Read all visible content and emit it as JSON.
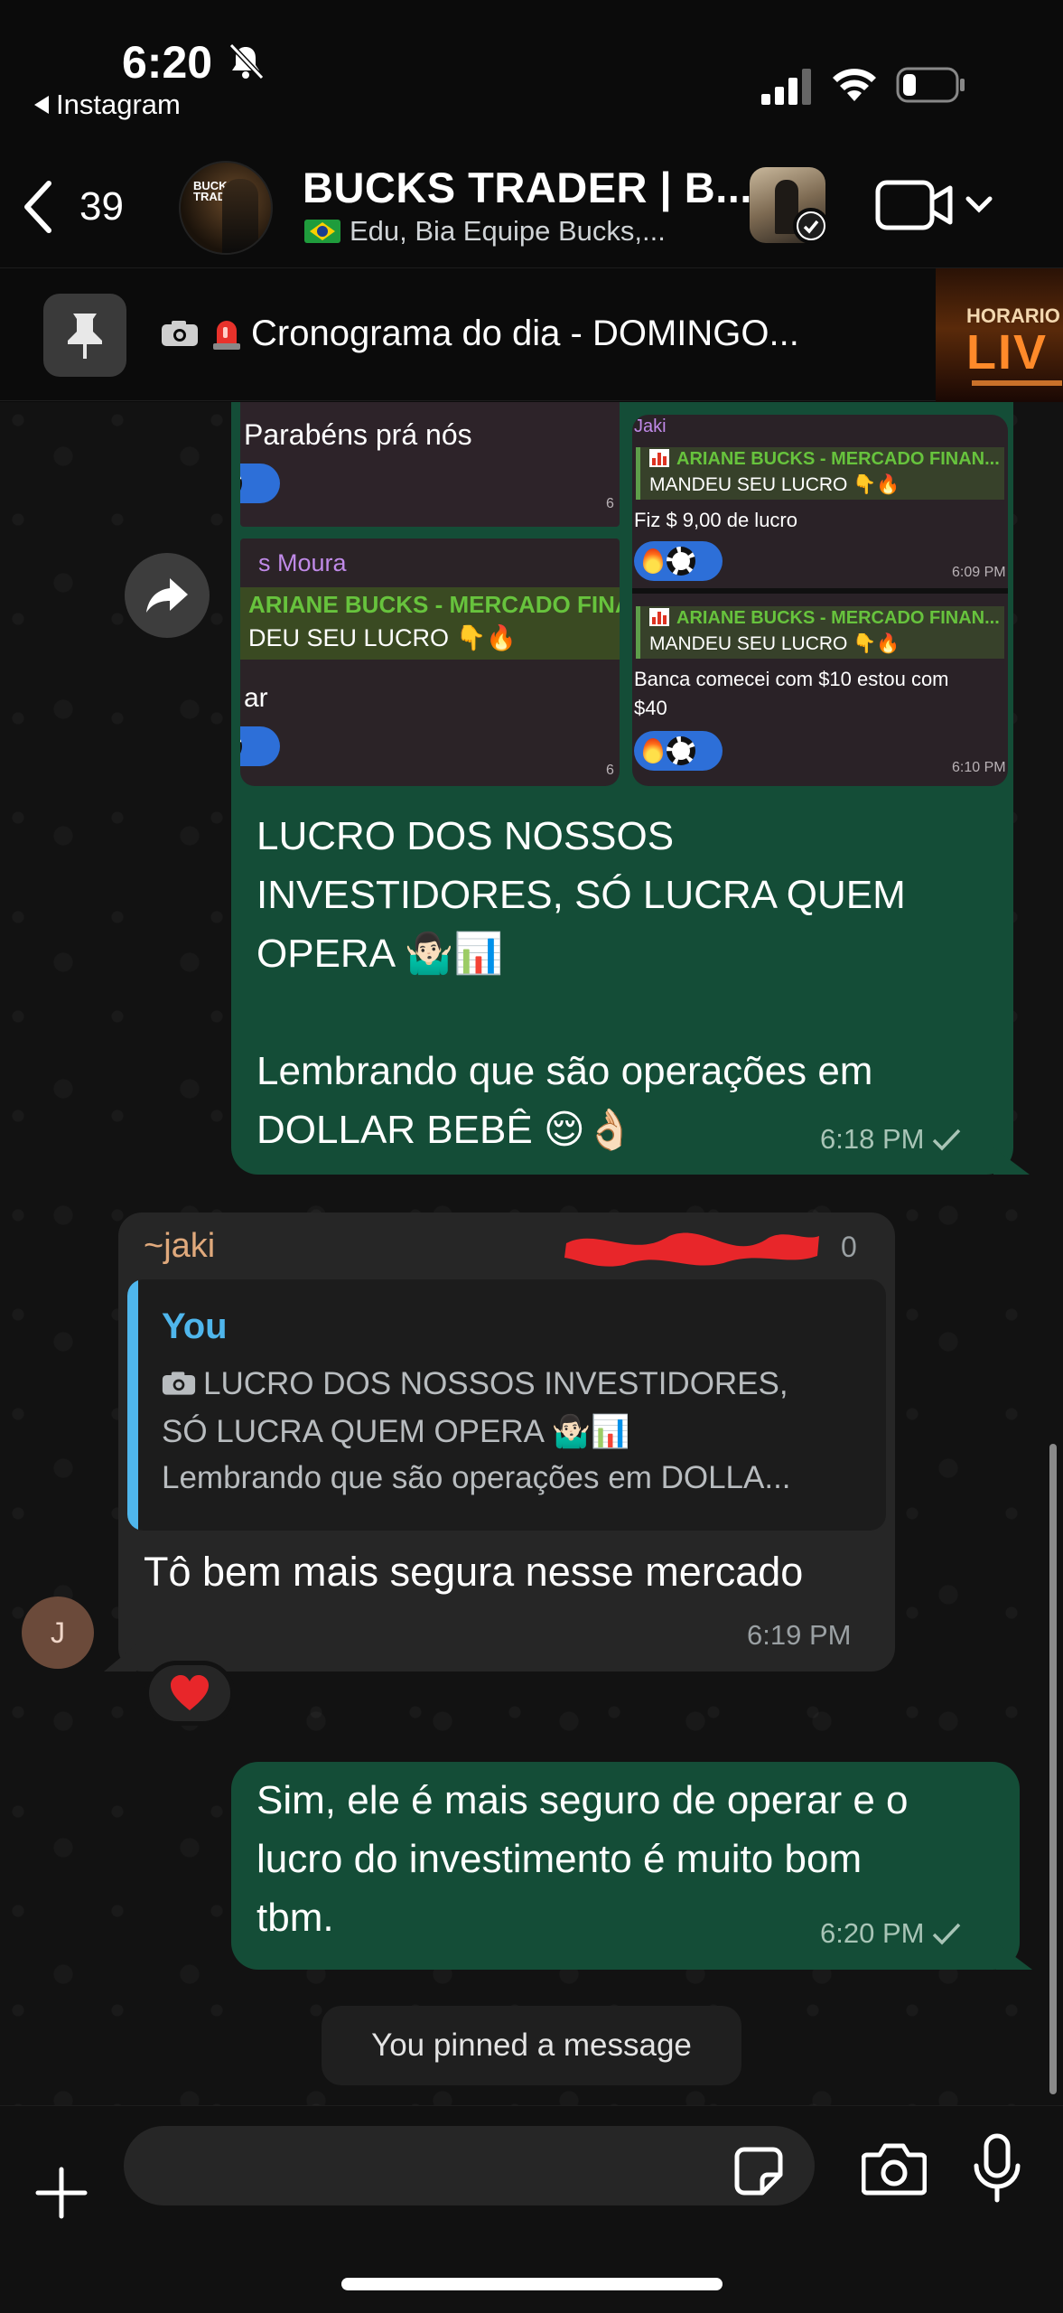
{
  "status_bar": {
    "time": "6:20",
    "back_app": "Instagram"
  },
  "header": {
    "back_count": "39",
    "title": "BUCKS TRADER | B...",
    "subtitle": "Edu, Bia Equipe Bucks,...",
    "avatar_logo": "BUCKS TRADER"
  },
  "pinned": {
    "text": "Cronograma do dia - DOMINGO...",
    "thumb_line1": "HORARIO",
    "thumb_line2": "LIV"
  },
  "media_message": {
    "panes": {
      "left_top_text": "Parabéns prá nós",
      "left_top_time": "6",
      "left_bottom_name": "s Moura",
      "left_bottom_quote_title": "ARIANE BUCKS - MERCADO FINA",
      "left_bottom_quote_text": "DEU SEU LUCRO",
      "left_bottom_text": "ar",
      "left_bottom_time": "6",
      "right_name": "Jaki",
      "right_quote1_title": "ARIANE BUCKS - MERCADO FINAN...",
      "right_quote1_text": "MANDEU SEU LUCRO",
      "right_text1": "Fiz $ 9,00 de lucro",
      "right_time1": "6:09 PM",
      "right_quote2_title": "ARIANE BUCKS - MERCADO FINAN...",
      "right_quote2_text": "MANDEU SEU LUCRO",
      "right_text2a": "Banca comecei com $10 estou com",
      "right_text2b": "$40",
      "right_time2": "6:10 PM"
    },
    "text_line1": "LUCRO DOS NOSSOS",
    "text_line2": "INVESTIDORES, SÓ LUCRA QUEM",
    "text_line3": "OPERA 🤷🏻‍♂️📊",
    "text_line4": "Lembrando que são operações em",
    "text_line5": "DOLLAR BEBÊ 😌👌🏻",
    "time": "6:18 PM"
  },
  "reply_message": {
    "sender": "~jaki",
    "sender_suffix": "0",
    "quote_author": "You",
    "quote_line1": "LUCRO DOS NOSSOS INVESTIDORES,",
    "quote_line2": "SÓ LUCRA QUEM OPERA 🤷🏻‍♂️📊",
    "quote_line3": "Lembrando que são operações em DOLLA...",
    "text": "Tô bem mais segura nesse mercado",
    "time": "6:19 PM",
    "avatar_letter": "J",
    "reaction": "❤️"
  },
  "outgoing_message": {
    "line1": "Sim, ele é mais seguro de operar e o",
    "line2": "lucro do investimento é muito bom",
    "line3": "tbm.",
    "time": "6:20 PM"
  },
  "system_note": "You pinned a message",
  "composer": {
    "placeholder": ""
  },
  "colors": {
    "outgoing_bubble": "#144d37",
    "incoming_bubble": "#262626",
    "reply_accent": "#4fb6ec",
    "sender_name": "#e0a97c"
  },
  "icons": [
    "bell-slash-icon",
    "signal-icon",
    "wifi-icon",
    "battery-icon",
    "back-chevron-icon",
    "video-call-icon",
    "chevron-down-icon",
    "pin-icon",
    "camera-icon",
    "siren-icon",
    "share-icon",
    "heart-icon",
    "plus-icon",
    "sticker-icon",
    "mic-icon",
    "checkmark-icon"
  ]
}
